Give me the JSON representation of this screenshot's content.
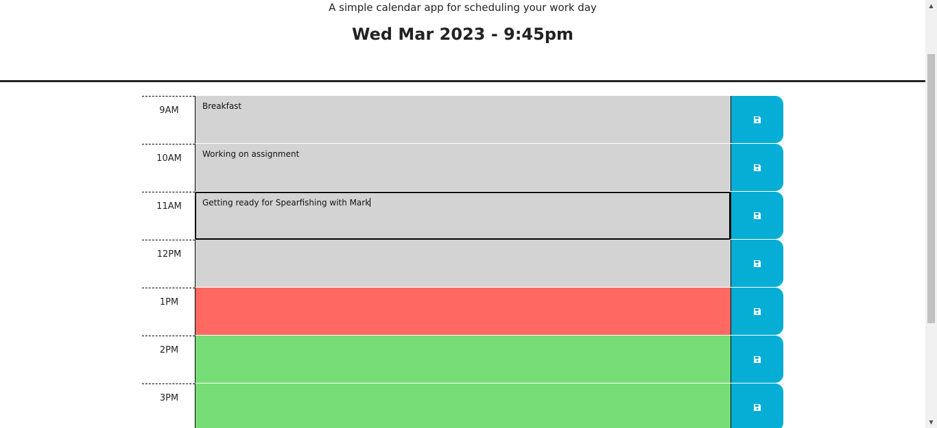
{
  "header": {
    "lead": "A simple calendar app for scheduling your work day",
    "current_day": "Wed Mar 2023 - 9:45pm"
  },
  "timeblocks": [
    {
      "hour": "9AM",
      "text": "Breakfast",
      "status": "past"
    },
    {
      "hour": "10AM",
      "text": "Working on assignment",
      "status": "past"
    },
    {
      "hour": "11AM",
      "text": "Getting ready for Spearfishing with Mark",
      "status": "past",
      "focused": true
    },
    {
      "hour": "12PM",
      "text": "",
      "status": "past"
    },
    {
      "hour": "1PM",
      "text": "",
      "status": "present"
    },
    {
      "hour": "2PM",
      "text": "",
      "status": "future"
    },
    {
      "hour": "3PM",
      "text": "",
      "status": "future"
    }
  ],
  "colors": {
    "past": "#d3d3d3",
    "present": "#ff6961",
    "future": "#77dd77",
    "save_button": "#06aed5",
    "save_icon": "#ffffff"
  },
  "icons": {
    "save": "floppy-disk-icon"
  }
}
